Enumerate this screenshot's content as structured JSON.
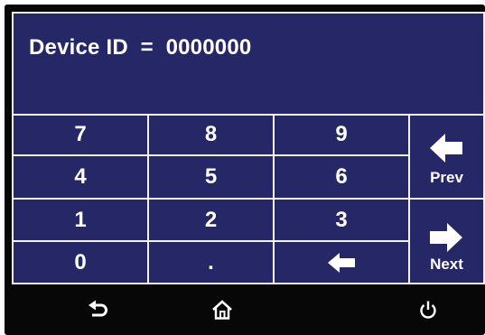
{
  "display": {
    "label": "Device ID",
    "equals": "=",
    "value": "0000000"
  },
  "keypad": {
    "k7": "7",
    "k8": "8",
    "k9": "9",
    "k4": "4",
    "k5": "5",
    "k6": "6",
    "k1": "1",
    "k2": "2",
    "k3": "3",
    "k0": "0",
    "dot": "."
  },
  "backspace_icon": "left-arrow-icon",
  "nav": {
    "prev_label": "Prev",
    "next_label": "Next"
  },
  "bottom_bar": {
    "back_icon": "return-arrow-icon",
    "home_icon": "home-icon",
    "power_icon": "power-icon"
  },
  "colors": {
    "panel": "#262766",
    "border": "#f2f2f2",
    "frame": "#070707",
    "text": "#ffffff"
  }
}
